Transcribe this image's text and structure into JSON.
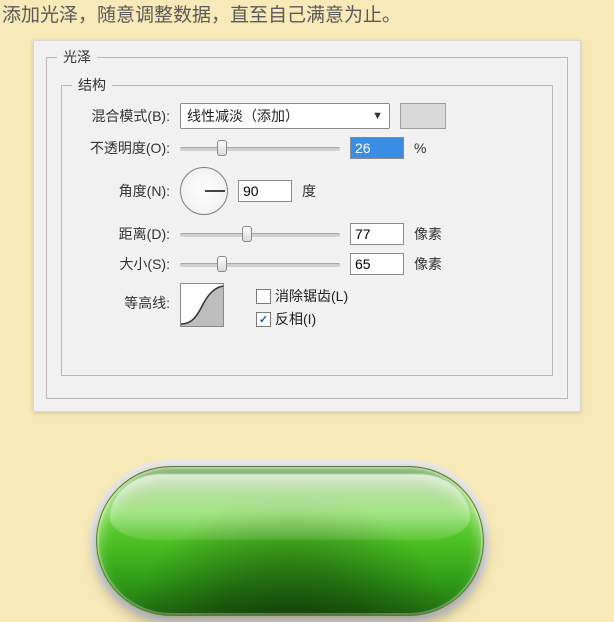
{
  "caption": "添加光泽，随意调整数据，直至自己满意为止。",
  "outer_group": "光泽",
  "inner_group": "结构",
  "blend_mode": {
    "label": "混合模式(B):",
    "value": "线性减淡（添加）"
  },
  "opacity": {
    "label": "不透明度(O):",
    "value": "26",
    "unit": "%",
    "slider_pct": 26
  },
  "angle": {
    "label": "角度(N):",
    "value": "90",
    "unit": "度",
    "deg": 90
  },
  "distance": {
    "label": "距离(D):",
    "value": "77",
    "unit": "像素",
    "slider_pct": 42
  },
  "size": {
    "label": "大小(S):",
    "value": "65",
    "unit": "像素",
    "slider_pct": 26
  },
  "contour": {
    "label": "等高线:"
  },
  "antialias": {
    "label": "消除锯齿(L)",
    "checked": false
  },
  "invert": {
    "label": "反相(I)",
    "checked": true
  },
  "swatch_color": "#d9d9d9"
}
